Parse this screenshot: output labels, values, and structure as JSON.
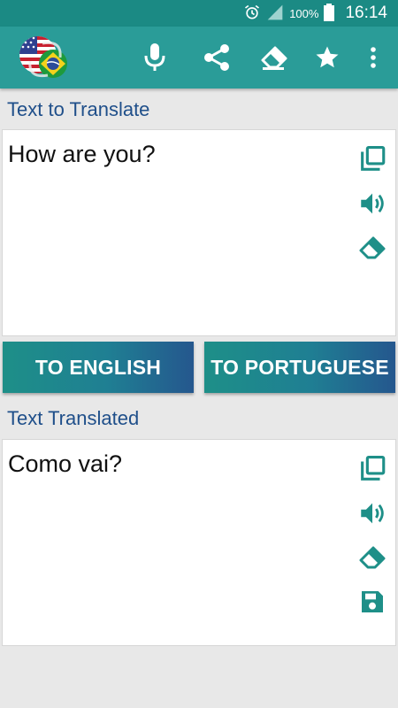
{
  "status_bar": {
    "battery_percent": "100%",
    "time": "16:14",
    "icons": [
      "alarm-icon",
      "signal-icon",
      "battery-icon"
    ]
  },
  "app_bar": {
    "logo": "us-brazil-flags-logo",
    "actions": [
      "microphone-icon",
      "share-icon",
      "eraser-icon",
      "star-icon",
      "more-vert-icon"
    ]
  },
  "source": {
    "label": "Text to Translate",
    "text": "How are you?",
    "actions": [
      "copy-icon",
      "speaker-icon",
      "eraser-icon"
    ]
  },
  "buttons": {
    "to_english": "TO ENGLISH",
    "to_portuguese": "TO PORTUGUESE"
  },
  "result": {
    "label": "Text Translated",
    "text": "Como vai?",
    "actions": [
      "copy-icon",
      "speaker-icon",
      "eraser-icon",
      "save-icon"
    ]
  },
  "colors": {
    "status_bar": "#1b8a84",
    "app_bar": "#2a9c98",
    "icon_teal": "#1e8f88",
    "label_blue": "#1f4f8a"
  }
}
